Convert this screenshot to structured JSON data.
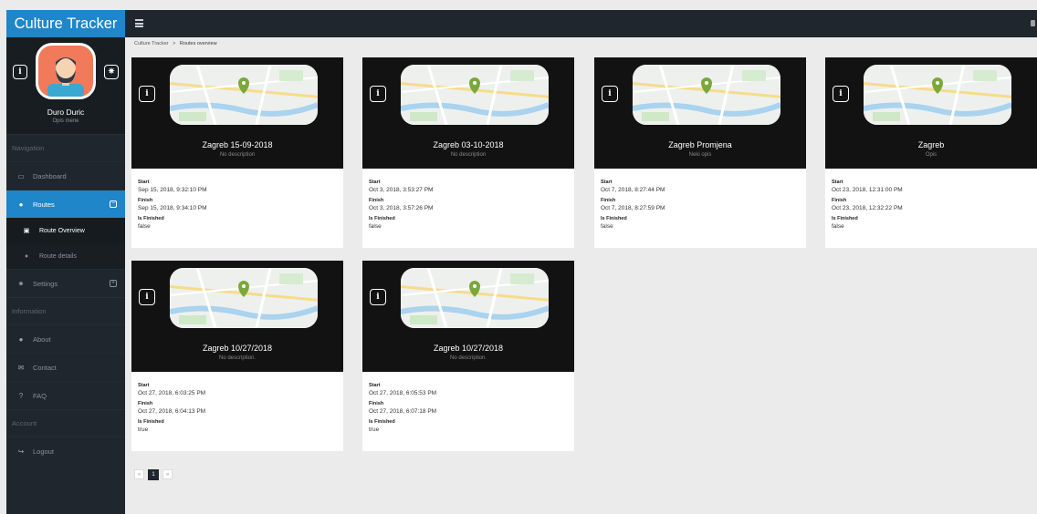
{
  "app": {
    "title": "Culture Tracker"
  },
  "profile": {
    "name": "Duro Duric",
    "subtitle": "Opis mene"
  },
  "sidebar": {
    "sections": [
      "Navigation",
      "Information",
      "Account"
    ],
    "items": {
      "dashboard": "Dashboard",
      "routes": "Routes",
      "route_overview": "Route Overview",
      "route_details": "Route details",
      "settings": "Settings",
      "about": "About",
      "contact": "Contact",
      "faq": "FAQ",
      "logout": "Logout"
    }
  },
  "breadcrumb": {
    "root": "Culture Tracker",
    "separator": ">",
    "current": "Routes overview"
  },
  "field_labels": {
    "start": "Start",
    "finish": "Finish",
    "is_finished": "Is Finished"
  },
  "routes": [
    {
      "title": "Zagreb 15-09-2018",
      "description": "No description",
      "start": "Sep 15, 2018, 9:32:10 PM",
      "finish": "Sep 15, 2018, 9:34:10 PM",
      "is_finished": "false"
    },
    {
      "title": "Zagreb 03-10-2018",
      "description": "No description",
      "start": "Oct 3, 2018, 3:53:27 PM",
      "finish": "Oct 3, 2018, 3:57:26 PM",
      "is_finished": "false"
    },
    {
      "title": "Zagreb Promjena",
      "description": "Neki opis",
      "start": "Oct 7, 2018, 8:27:44 PM",
      "finish": "Oct 7, 2018, 8:27:59 PM",
      "is_finished": "false"
    },
    {
      "title": "Zagreb",
      "description": "Opis",
      "start": "Oct 23, 2018, 12:31:00 PM",
      "finish": "Oct 23, 2018, 12:32:22 PM",
      "is_finished": "false"
    },
    {
      "title": "Zagreb 10/27/2018",
      "description": "No description.",
      "start": "Oct 27, 2018, 6:03:25 PM",
      "finish": "Oct 27, 2018, 6:04:13 PM",
      "is_finished": "true"
    },
    {
      "title": "Zagreb 10/27/2018",
      "description": "No description.",
      "start": "Oct 27, 2018, 6:05:53 PM",
      "finish": "Oct 27, 2018, 6:07:18 PM",
      "is_finished": "true"
    }
  ],
  "pagination": {
    "prev": "«",
    "current": "1",
    "next": "»"
  },
  "colors": {
    "accent": "#1f86c9",
    "sidebar": "#1f262d",
    "card_head": "#121212"
  },
  "icons": {
    "menu_toggle": "menu-icon",
    "info": "info-icon",
    "settings": "gear-icon",
    "dashboard": "monitor-icon",
    "routes": "globe-icon",
    "route_overview": "image-icon",
    "route_details": "map-marker-icon",
    "about": "info-circle-icon",
    "contact": "envelope-icon",
    "faq": "question-icon",
    "logout": "sign-out-icon"
  }
}
